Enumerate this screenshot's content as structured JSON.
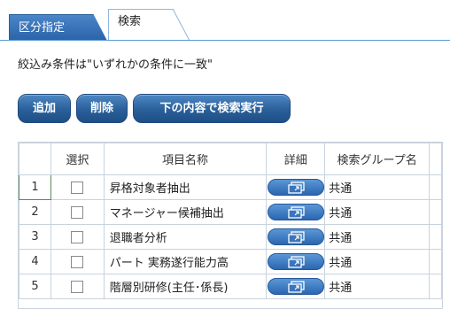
{
  "tabs": [
    {
      "label": "区分指定",
      "active": false
    },
    {
      "label": "検索",
      "active": true
    }
  ],
  "condition_text": "絞込み条件は\"いずれかの条件に一致\"",
  "buttons": {
    "add": "追加",
    "delete": "削除",
    "search": "下の内容で検索実行"
  },
  "table": {
    "headers": {
      "select": "選択",
      "item_name": "項目名称",
      "detail": "詳細",
      "group": "検索グループ名"
    },
    "rows": [
      {
        "num": "1",
        "name": "昇格対象者抽出",
        "group": "共通"
      },
      {
        "num": "2",
        "name": "マネージャー候補抽出",
        "group": "共通"
      },
      {
        "num": "3",
        "name": "退職者分析",
        "group": "共通"
      },
      {
        "num": "4",
        "name": "パート 実務遂行能力高",
        "group": "共通"
      },
      {
        "num": "5",
        "name": "階層別研修(主任･係長)",
        "group": "共通"
      }
    ]
  },
  "colors": {
    "accent": "#2b62a8",
    "tab_border": "#5b9bd5"
  },
  "icons": {
    "detail": "popup-window-icon"
  }
}
